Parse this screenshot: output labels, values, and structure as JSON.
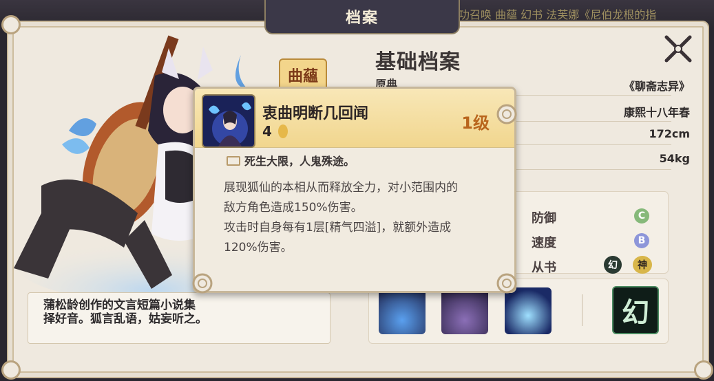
{
  "header": {
    "title": "档案",
    "marquee": "成功召唤 曲蘊 幻书 法芙娜《尼伯龙根的指"
  },
  "profile": {
    "section_title": "基础档案",
    "origin_label": "原典",
    "rows": [
      {
        "value": "《聊斋志异》"
      },
      {
        "value": "康熙十八年春"
      },
      {
        "value": "172cm"
      },
      {
        "value": "54kg"
      }
    ]
  },
  "stats": [
    {
      "label": "防御",
      "grade": "C",
      "color": "#86b97a"
    },
    {
      "label": "速度",
      "grade": "B",
      "color": "#8d96d9"
    }
  ],
  "tags": {
    "label": "从书",
    "tag1": "幻",
    "tag2": "神"
  },
  "description": {
    "line1": "蒲松龄创作的文言短篇小说集",
    "line2": "择好音。狐言乱语，姑妄听之。"
  },
  "badge_text": "曲蘊",
  "skill_badge": "幻",
  "tooltip": {
    "name": "衷曲明断几回闻",
    "cost": "4",
    "level": "1级",
    "quote": "死生大限，人鬼殊途。",
    "body_line1": "展现狐仙的本相从而释放全力，对小范围内的",
    "body_line2": "敌方角色造成150%伤害。",
    "body_line3": "攻击时自身每有1层[精气四溢]，就额外造成",
    "body_line4": "120%伤害。"
  },
  "colors": {
    "accent_level": "#b9651d",
    "panel_bg": "#efe9df",
    "tab_bg": "#3b3848"
  }
}
